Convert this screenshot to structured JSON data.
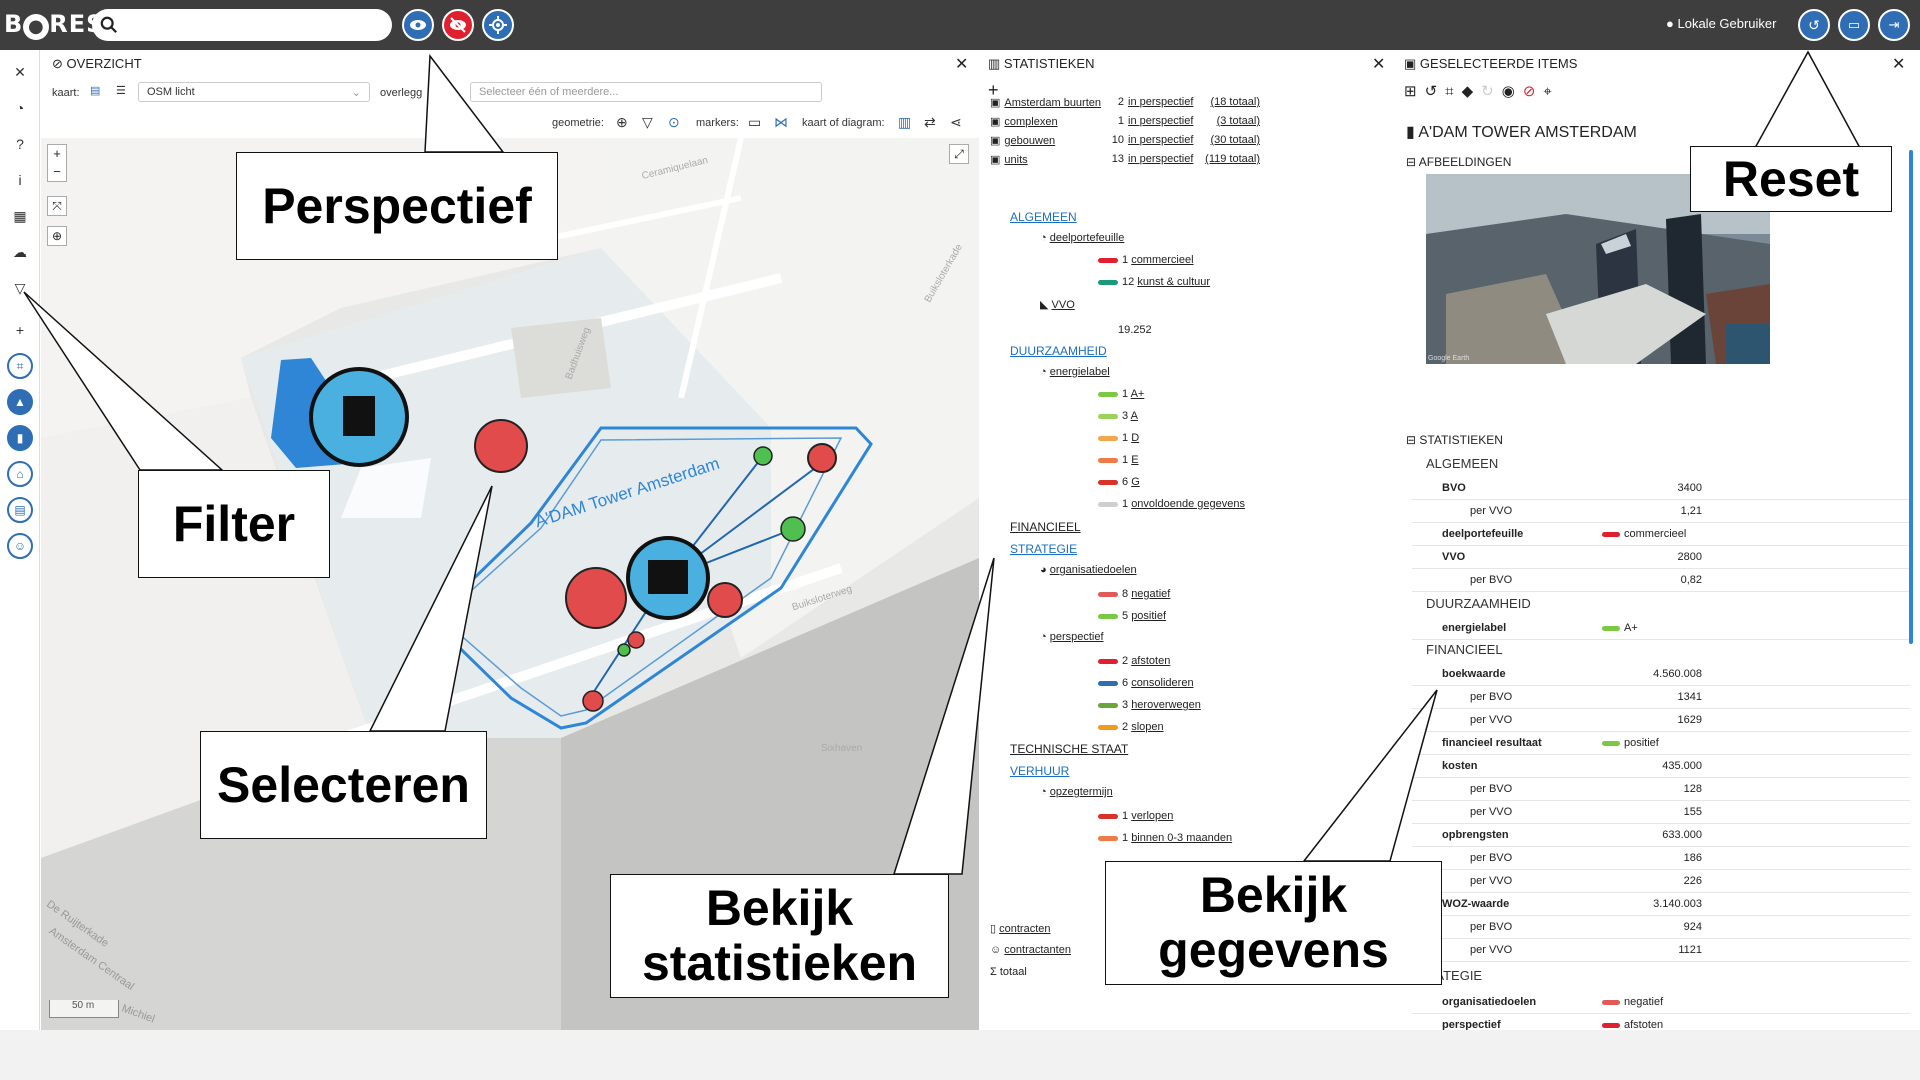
{
  "topbar": {
    "logo_b": "B",
    "logo_rest": "RES",
    "search_placeholder": "",
    "user": "Lokale Gebruiker"
  },
  "overzicht": {
    "title": "OVERZICHT",
    "kaart_label": "kaart:",
    "kaart_value": "OSM licht",
    "overlegg_label": "overlegg",
    "overlay_placeholder": "Selecteer één of meerdere...",
    "geometrie_label": "geometrie:",
    "markers_label": "markers:",
    "diagram_label": "kaart of diagram:",
    "scale": "50 m"
  },
  "map": {
    "tower_label": "A'DAM Tower Amsterdam",
    "streets": [
      "Ceramiquelaan",
      "Badhuisweg",
      "Buiksloterweg",
      "Sixhaven",
      "Buiksloterkade",
      "De Ruijterkade",
      "Amsterdam Centraal",
      "Michiel"
    ]
  },
  "stats": {
    "title": "STATISTIEKEN",
    "counts": [
      {
        "label": "Amsterdam buurten",
        "n": "2",
        "persp": "in perspectief",
        "total": "(18 totaal)"
      },
      {
        "label": "complexen",
        "n": "1",
        "persp": "in perspectief",
        "total": "(3 totaal)"
      },
      {
        "label": "gebouwen",
        "n": "10",
        "persp": "in perspectief",
        "total": "(30 totaal)"
      },
      {
        "label": "units",
        "n": "13",
        "persp": "in perspectief",
        "total": "(119 totaal)"
      }
    ],
    "algemeen": "ALGEMEEN",
    "deelportefeuille": "deelportefeuille",
    "dp_items": [
      {
        "n": "1",
        "label": "commercieel",
        "color": "#e0202f"
      },
      {
        "n": "12",
        "label": "kunst & cultuur",
        "color": "#1a9a7a"
      }
    ],
    "vvo": "VVO",
    "vvo_value": "19.252",
    "duurzaamheid": "DUURZAAMHEID",
    "energielabel": "energielabel",
    "el_items": [
      {
        "n": "1",
        "label": "A+",
        "color": "#7ac943"
      },
      {
        "n": "3",
        "label": "A",
        "color": "#9bd35a"
      },
      {
        "n": "1",
        "label": "D",
        "color": "#f5a64d"
      },
      {
        "n": "1",
        "label": "E",
        "color": "#ef7a46"
      },
      {
        "n": "6",
        "label": "G",
        "color": "#d9322b"
      },
      {
        "n": "1",
        "label": "onvoldoende gegevens",
        "color": "#cfcfcf"
      }
    ],
    "financieel": "FINANCIEEL",
    "strategie": "STRATEGIE",
    "organisatiedoelen": "organisatiedoelen",
    "od_items": [
      {
        "n": "8",
        "label": "negatief",
        "color": "#e05a5a"
      },
      {
        "n": "5",
        "label": "positief",
        "color": "#7ac943"
      }
    ],
    "perspectief": "perspectief",
    "ps_items": [
      {
        "n": "2",
        "label": "afstoten",
        "color": "#e0202f"
      },
      {
        "n": "6",
        "label": "consolideren",
        "color": "#2f6eb5"
      },
      {
        "n": "3",
        "label": "heroverwegen",
        "color": "#6aa63c"
      },
      {
        "n": "2",
        "label": "slopen",
        "color": "#f29a1f"
      }
    ],
    "technische": "TECHNISCHE STAAT",
    "verhuur": "VERHUUR",
    "opzegtermijn": "opzegtermijn",
    "oz_items": [
      {
        "n": "1",
        "label": "verlopen",
        "color": "#d9322b"
      },
      {
        "n": "1",
        "label": "binnen 0-3 maanden",
        "color": "#ef7a46"
      }
    ],
    "footer": [
      "contracten",
      "contractanten",
      "totaal"
    ]
  },
  "geg": {
    "title": "GESELECTEERDE ITEMS",
    "item": "A'DAM TOWER AMSTERDAM",
    "afbeeldingen": "AFBEELDINGEN",
    "statistieken": "STATISTIEKEN",
    "photo_credit": "Google Earth",
    "algemeen": "ALGEMEEN",
    "duurzaamheid": "DUURZAAMHEID",
    "financieel": "FINANCIEEL",
    "strategie": "RATEGIE",
    "rows": [
      {
        "k": "BVO",
        "v": "3400",
        "sub": false,
        "num": true
      },
      {
        "k": "per VVO",
        "v": "1,21",
        "sub": true,
        "num": true
      },
      {
        "k": "deelportefeuille",
        "v": "commercieel",
        "sub": false,
        "num": false,
        "color": "#e0202f"
      },
      {
        "k": "VVO",
        "v": "2800",
        "sub": false,
        "num": true
      },
      {
        "k": "per BVO",
        "v": "0,82",
        "sub": true,
        "num": true
      },
      {
        "k": "energielabel",
        "v": "A+",
        "sub": false,
        "num": false,
        "color": "#7ac943"
      },
      {
        "k": "boekwaarde",
        "v": "4.560.008",
        "sub": false,
        "num": true
      },
      {
        "k": "per BVO",
        "v": "1341",
        "sub": true,
        "num": true
      },
      {
        "k": "per VVO",
        "v": "1629",
        "sub": true,
        "num": true
      },
      {
        "k": "financieel resultaat",
        "v": "positief",
        "sub": false,
        "num": false,
        "color": "#7ac943"
      },
      {
        "k": "kosten",
        "v": "435.000",
        "sub": false,
        "num": true
      },
      {
        "k": "per BVO",
        "v": "128",
        "sub": true,
        "num": true
      },
      {
        "k": "per VVO",
        "v": "155",
        "sub": true,
        "num": true
      },
      {
        "k": "opbrengsten",
        "v": "633.000",
        "sub": false,
        "num": true
      },
      {
        "k": "per BVO",
        "v": "186",
        "sub": true,
        "num": true
      },
      {
        "k": "per VVO",
        "v": "226",
        "sub": true,
        "num": true
      },
      {
        "k": "WOZ-waarde",
        "v": "3.140.003",
        "sub": false,
        "num": true
      },
      {
        "k": "per BVO",
        "v": "924",
        "sub": true,
        "num": true
      },
      {
        "k": "per VVO",
        "v": "1121",
        "sub": true,
        "num": true
      },
      {
        "k": "organisatiedoelen",
        "v": "negatief",
        "sub": false,
        "num": false,
        "color": "#e05a5a"
      },
      {
        "k": "perspectief",
        "v": "afstoten",
        "sub": false,
        "num": false,
        "color": "#e0202f"
      }
    ]
  },
  "callouts": {
    "perspectief": "Perspectief",
    "reset": "Reset",
    "filter": "Filter",
    "selecteren": "Selecteren",
    "statistieken_1": "Bekijk",
    "statistieken_2": "statistieken",
    "gegevens_1": "Bekijk",
    "gegevens_2": "gegevens"
  }
}
